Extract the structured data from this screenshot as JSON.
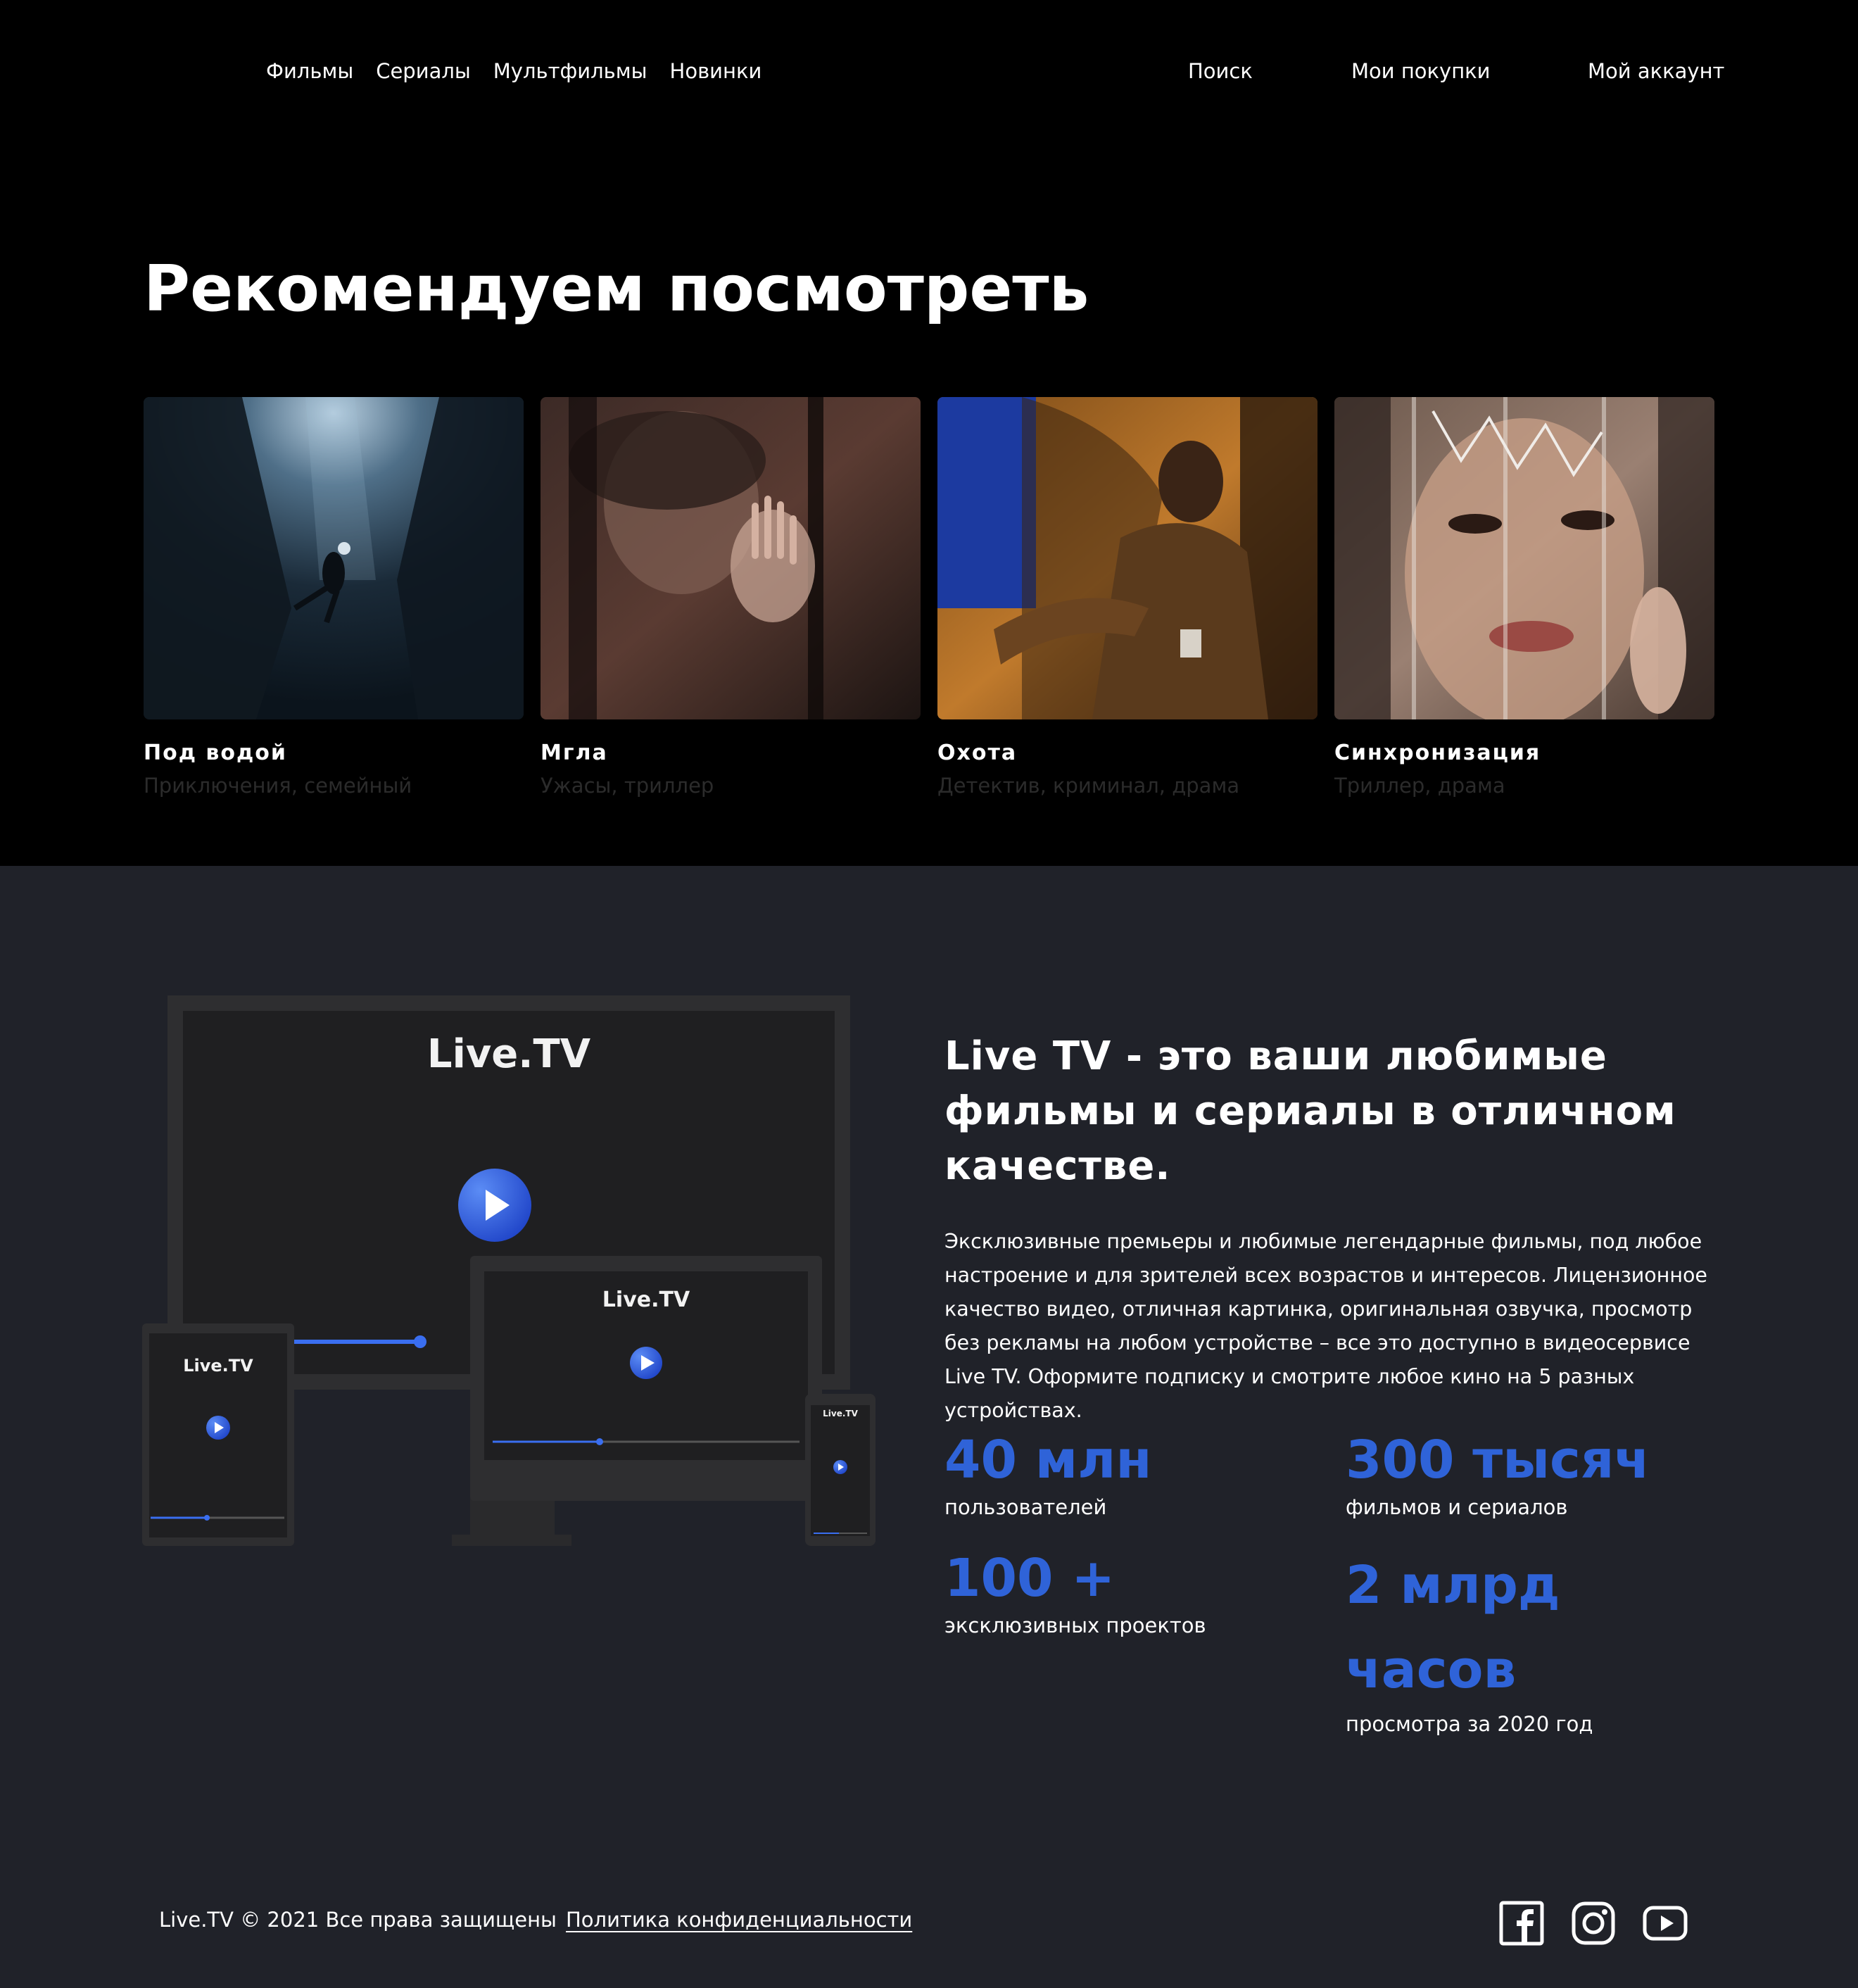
{
  "nav": {
    "left": [
      "Фильмы",
      "Сериалы",
      "Мультфильмы",
      "Новинки"
    ],
    "search": "Поиск",
    "purchases": "Мои покупки",
    "account": "Мой аккаунт"
  },
  "recommend": {
    "title": "Рекомендуем посмотреть",
    "cards": [
      {
        "title": "Под водой",
        "genre": "Приключения, семейный"
      },
      {
        "title": "Мгла",
        "genre": "Ужасы, триллер"
      },
      {
        "title": "Охота",
        "genre": "Детектив, криминал, драма"
      },
      {
        "title": "Синхронизация",
        "genre": "Триллер, драма"
      }
    ]
  },
  "devices": {
    "logo": "Live.TV"
  },
  "about": {
    "title": "Live TV - это ваши любимые фильмы и сериалы в отличном качестве.",
    "text": "Эксклюзивные премьеры и любимые легендарные фильмы, под любое настроение и для зрителей всех возрастов и интересов. Лицензионное качество видео, отличная картинка, оригинальная озвучка, просмотр без рекламы на любом устройстве – все это доступно в видеосервисе Live TV. Оформите подписку и смотрите любое кино на 5 разных устройствах.",
    "stats": [
      {
        "value": "40 млн",
        "label": "пользователей"
      },
      {
        "value": "300 тысяч",
        "label": "фильмов и сериалов"
      },
      {
        "value": "100 +",
        "label": "эксклюзивных проектов"
      },
      {
        "value": "2 млрд часов",
        "label": "просмотра за 2020 год"
      }
    ]
  },
  "footer": {
    "copyright": "Live.TV © 2021 Все права защищены",
    "privacy": "Политика конфиденциальности",
    "social": [
      "facebook-icon",
      "instagram-icon",
      "youtube-icon"
    ]
  },
  "colors": {
    "accent": "#2f63d8",
    "section_bg": "#202229",
    "header_bg": "#000000"
  }
}
